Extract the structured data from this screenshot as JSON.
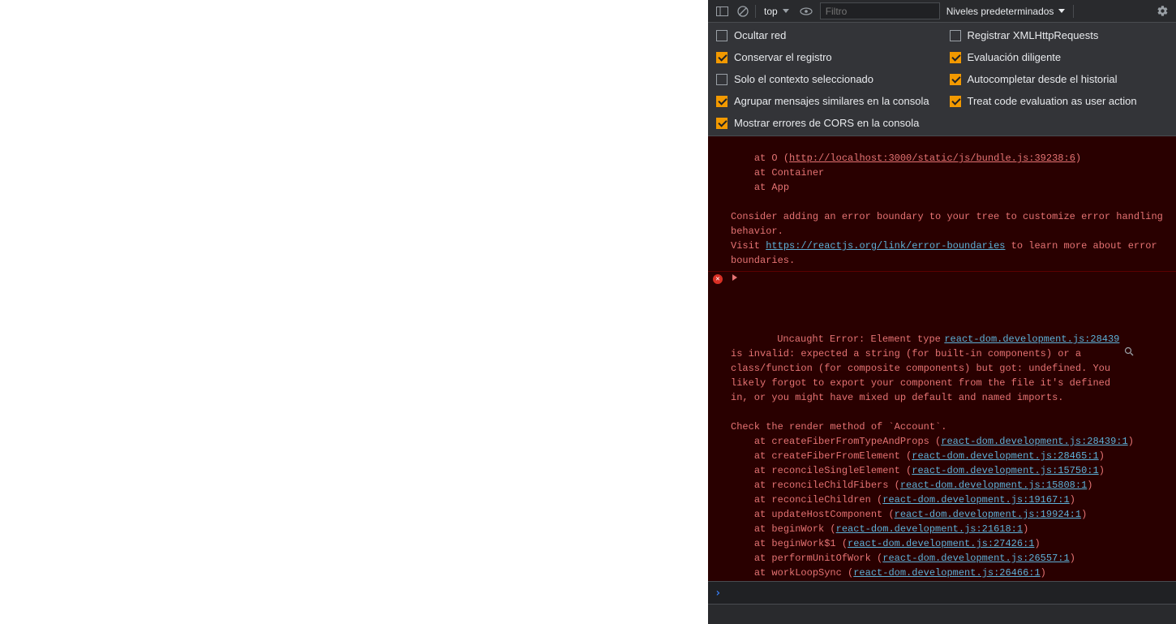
{
  "toolbar": {
    "context": "top",
    "filter_placeholder": "Filtro",
    "levels_label": "Niveles predeterminados"
  },
  "settings": {
    "left": [
      {
        "label": "Ocultar red",
        "checked": false
      },
      {
        "label": "Conservar el registro",
        "checked": true
      },
      {
        "label": "Solo el contexto seleccionado",
        "checked": false
      },
      {
        "label": "Agrupar mensajes similares en la consola",
        "checked": true
      },
      {
        "label": "Mostrar errores de CORS en la consola",
        "checked": true
      }
    ],
    "right": [
      {
        "label": "Registrar XMLHttpRequests",
        "checked": false
      },
      {
        "label": "Evaluación diligente",
        "checked": true
      },
      {
        "label": "Autocompletar desde el historial",
        "checked": true
      },
      {
        "label": "Treat code evaluation as user action",
        "checked": true
      }
    ]
  },
  "error1": {
    "stack_top_linktext": "http://localhost:3000/static/js/bundle.js:39238:6",
    "stack_lines": [
      "    at Container",
      "    at App"
    ],
    "hint1": "Consider adding an error boundary to your tree to customize error handling behavior.",
    "hint2a": "Visit ",
    "hint2_link": "https://reactjs.org/link/error-boundaries",
    "hint2b": " to learn more about error boundaries."
  },
  "error2": {
    "source_link": "react-dom.development.js:28439",
    "msg": "Uncaught Error: Element type is invalid: expected a string (for built-in components) or a class/function (for composite components) but got: undefined. You likely forgot to export your component from the file it's defined in, or you might have mixed up default and named imports.\n\nCheck the render method of `Account`.",
    "frames": [
      {
        "pre": "    at createFiberFromTypeAndProps (",
        "link": "react-dom.development.js:28439:1",
        "post": ")"
      },
      {
        "pre": "    at createFiberFromElement (",
        "link": "react-dom.development.js:28465:1",
        "post": ")"
      },
      {
        "pre": "    at reconcileSingleElement (",
        "link": "react-dom.development.js:15750:1",
        "post": ")"
      },
      {
        "pre": "    at reconcileChildFibers (",
        "link": "react-dom.development.js:15808:1",
        "post": ")"
      },
      {
        "pre": "    at reconcileChildren (",
        "link": "react-dom.development.js:19167:1",
        "post": ")"
      },
      {
        "pre": "    at updateHostComponent (",
        "link": "react-dom.development.js:19924:1",
        "post": ")"
      },
      {
        "pre": "    at beginWork (",
        "link": "react-dom.development.js:21618:1",
        "post": ")"
      },
      {
        "pre": "    at beginWork$1 (",
        "link": "react-dom.development.js:27426:1",
        "post": ")"
      },
      {
        "pre": "    at performUnitOfWork (",
        "link": "react-dom.development.js:26557:1",
        "post": ")"
      },
      {
        "pre": "    at workLoopSync (",
        "link": "react-dom.development.js:26466:1",
        "post": ")"
      }
    ]
  }
}
